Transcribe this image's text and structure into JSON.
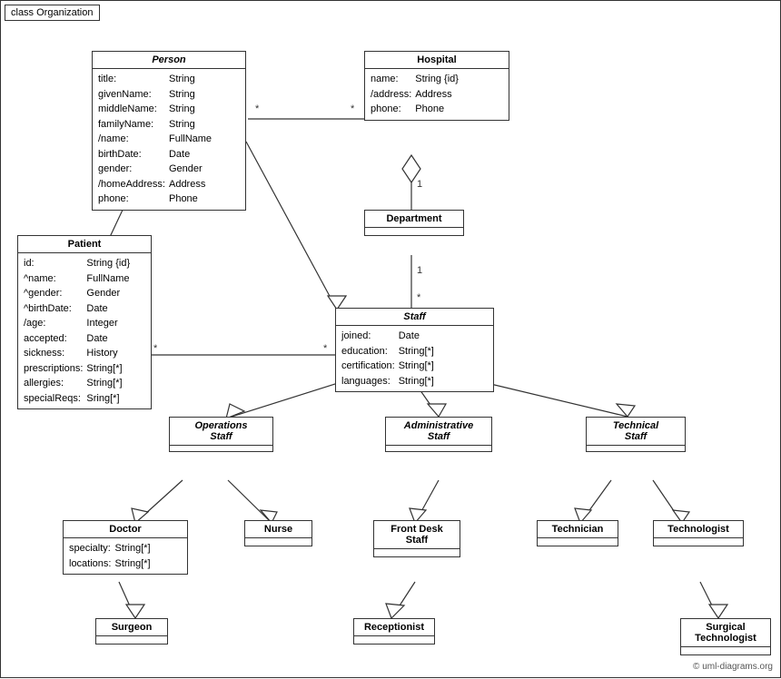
{
  "diagram": {
    "title": "class Organization",
    "copyright": "© uml-diagrams.org",
    "classes": {
      "person": {
        "name": "Person",
        "italic": true,
        "attributes": [
          [
            "title:",
            "String"
          ],
          [
            "givenName:",
            "String"
          ],
          [
            "middleName:",
            "String"
          ],
          [
            "familyName:",
            "String"
          ],
          [
            "/name:",
            "FullName"
          ],
          [
            "birthDate:",
            "Date"
          ],
          [
            "gender:",
            "Gender"
          ],
          [
            "/homeAddress:",
            "Address"
          ],
          [
            "phone:",
            "Phone"
          ]
        ]
      },
      "hospital": {
        "name": "Hospital",
        "italic": false,
        "attributes": [
          [
            "name:",
            "String {id}"
          ],
          [
            "/address:",
            "Address"
          ],
          [
            "phone:",
            "Phone"
          ]
        ]
      },
      "department": {
        "name": "Department",
        "italic": false,
        "attributes": []
      },
      "staff": {
        "name": "Staff",
        "italic": true,
        "attributes": [
          [
            "joined:",
            "Date"
          ],
          [
            "education:",
            "String[*]"
          ],
          [
            "certification:",
            "String[*]"
          ],
          [
            "languages:",
            "String[*]"
          ]
        ]
      },
      "patient": {
        "name": "Patient",
        "italic": false,
        "attributes": [
          [
            "id:",
            "String {id}"
          ],
          [
            "^name:",
            "FullName"
          ],
          [
            "^gender:",
            "Gender"
          ],
          [
            "^birthDate:",
            "Date"
          ],
          [
            "/age:",
            "Integer"
          ],
          [
            "accepted:",
            "Date"
          ],
          [
            "sickness:",
            "History"
          ],
          [
            "prescriptions:",
            "String[*]"
          ],
          [
            "allergies:",
            "String[*]"
          ],
          [
            "specialReqs:",
            "Sring[*]"
          ]
        ]
      },
      "operations_staff": {
        "name": "Operations Staff",
        "italic": true,
        "attributes": []
      },
      "administrative_staff": {
        "name": "Administrative Staff",
        "italic": true,
        "attributes": []
      },
      "technical_staff": {
        "name": "Technical Staff",
        "italic": true,
        "attributes": []
      },
      "doctor": {
        "name": "Doctor",
        "italic": false,
        "attributes": [
          [
            "specialty:",
            "String[*]"
          ],
          [
            "locations:",
            "String[*]"
          ]
        ]
      },
      "nurse": {
        "name": "Nurse",
        "italic": false,
        "attributes": []
      },
      "front_desk_staff": {
        "name": "Front Desk Staff",
        "italic": false,
        "attributes": []
      },
      "technician": {
        "name": "Technician",
        "italic": false,
        "attributes": []
      },
      "technologist": {
        "name": "Technologist",
        "italic": false,
        "attributes": []
      },
      "surgeon": {
        "name": "Surgeon",
        "italic": false,
        "attributes": []
      },
      "receptionist": {
        "name": "Receptionist",
        "italic": false,
        "attributes": []
      },
      "surgical_technologist": {
        "name": "Surgical Technologist",
        "italic": false,
        "attributes": []
      }
    }
  }
}
